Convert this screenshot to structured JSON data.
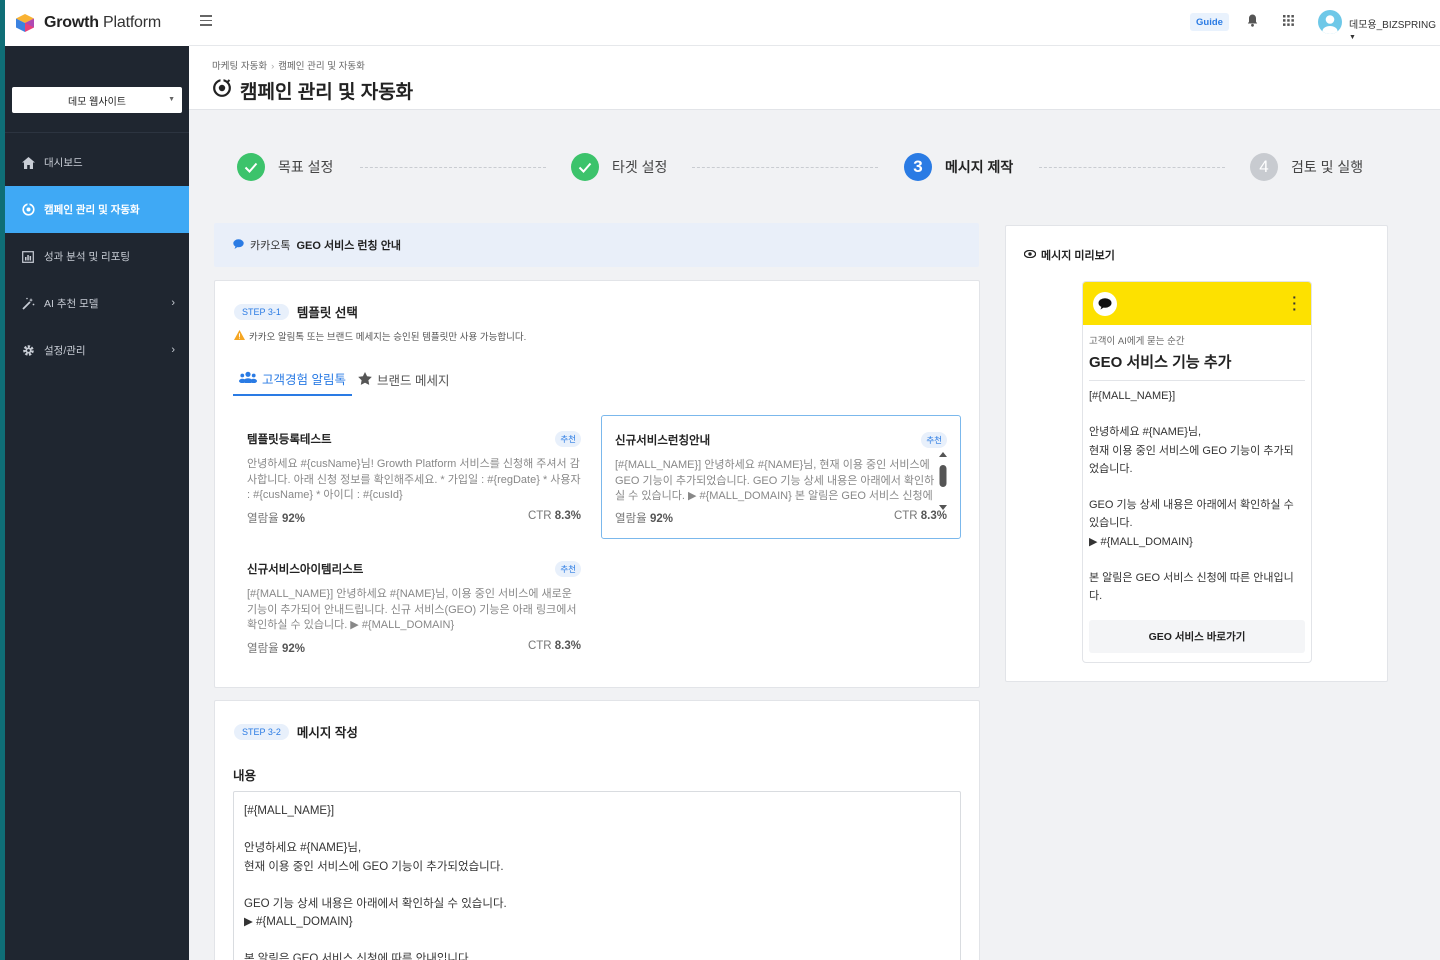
{
  "app": {
    "logo_bold": "Growth",
    "logo_light": " Platform"
  },
  "topbar": {
    "guide_label": "Guide",
    "user_name": "데모용_BIZSPRING"
  },
  "sidebar": {
    "site_select": "데모 웹사이트",
    "items": [
      {
        "label": "대시보드",
        "icon": "home-icon"
      },
      {
        "label": "캠페인 관리 및 자동화",
        "icon": "campaign-icon"
      },
      {
        "label": "성과 분석 및 리포팅",
        "icon": "report-icon"
      },
      {
        "label": "AI 추천 모델",
        "icon": "ai-icon"
      },
      {
        "label": "설정/관리",
        "icon": "gear-icon"
      }
    ]
  },
  "header": {
    "breadcrumb": [
      "마케팅 자동화",
      "캠페인 관리 및 자동화"
    ],
    "title": "캠페인 관리 및 자동화"
  },
  "stepper": {
    "steps": [
      {
        "label": "목표 설정",
        "status": "done",
        "marker": "✓"
      },
      {
        "label": "타겟 설정",
        "status": "done",
        "marker": "✓"
      },
      {
        "label": "메시지 제작",
        "status": "current",
        "marker": "3"
      },
      {
        "label": "검토 및 실행",
        "status": "todo",
        "marker": "4"
      }
    ]
  },
  "banner": {
    "channel": "카카오톡",
    "campaign_name": "GEO 서비스 런칭 안내"
  },
  "template_section": {
    "step_badge": "STEP 3-1",
    "title": "템플릿 선택",
    "warning": "카카오 알림톡 또는 브랜드 메세지는 승인된 템플릿만 사용 가능합니다.",
    "tabs": [
      {
        "label": "고객경험 알림톡",
        "active": true
      },
      {
        "label": "브랜드 메세지",
        "active": false
      }
    ],
    "templates": [
      {
        "name": "템플릿등록테스트",
        "badge": "추천",
        "body": "안녕하세요 #{cusName}님! Growth Platform 서비스를 신청해 주셔서 감사합니다. 아래 신청 정보를 확인해주세요. * 가입일 : #{regDate} * 사용자 : #{cusName} * 아이디 : #{cusId}",
        "open_rate_label": "열람율",
        "open_rate": "92%",
        "ctr_label": "CTR",
        "ctr": "8.3%"
      },
      {
        "name": "신규서비스런칭안내",
        "badge": "추천",
        "body": "[#{MALL_NAME}] 안녕하세요 #{NAME}님, 현재 이용 중인 서비스에 GEO 기능이 추가되었습니다. GEO 기능 상세 내용은 아래에서 확인하실 수 있습니다. ▶ #{MALL_DOMAIN} 본 알림은 GEO 서비스 신청에 따른 안내입니다.",
        "open_rate_label": "열람율",
        "open_rate": "92%",
        "ctr_label": "CTR",
        "ctr": "8.3%"
      },
      {
        "name": "신규서비스아이템리스트",
        "badge": "추천",
        "body": "[#{MALL_NAME}] 안녕하세요 #{NAME}님, 이용 중인 서비스에 새로운 기능이 추가되어 안내드립니다. 신규 서비스(GEO) 기능은 아래 링크에서 확인하실 수 있습니다. ▶ #{MALL_DOMAIN}",
        "open_rate_label": "열람율",
        "open_rate": "92%",
        "ctr_label": "CTR",
        "ctr": "8.3%"
      }
    ]
  },
  "message_section": {
    "step_badge": "STEP 3-2",
    "title": "메시지 작성",
    "content_label": "내용",
    "content": "[#{MALL_NAME}]\n\n안녕하세요 #{NAME}님,\n현재 이용 중인 서비스에 GEO 기능이 추가되었습니다.\n\nGEO 기능 상세 내용은 아래에서 확인하실 수 있습니다.\n▶ #{MALL_DOMAIN}\n\n본 알림은 GEO 서비스 신청에 따른 안내입니다."
  },
  "preview": {
    "title": "메시지 미리보기",
    "subtitle": "고객이 AI에게 묻는 순간",
    "headline": "GEO 서비스 기능 추가",
    "body": "[#{MALL_NAME}]\n\n안녕하세요 #{NAME}님,\n현재 이용 중인 서비스에 GEO 기능이 추가되었습니다.\n\nGEO 기능 상세 내용은 아래에서 확인하실 수 있습니다.\n▶ #{MALL_DOMAIN}\n\n본 알림은 GEO 서비스 신청에 따른 안내입니다.",
    "button_label": "GEO 서비스 바로가기"
  },
  "colors": {
    "sidebar_bg": "#1f2630",
    "active_nav": "#3fa9f5",
    "primary": "#2a7be4",
    "done": "#3cc36b",
    "kakao_yellow": "#fde100"
  }
}
